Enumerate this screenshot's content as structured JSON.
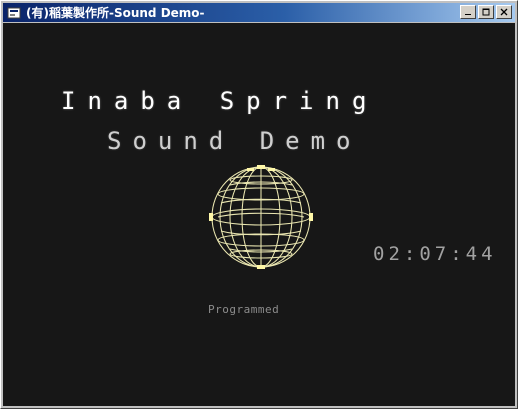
{
  "window": {
    "title": "(有)稲葉製作所-Sound Demo-",
    "controls": {
      "minimize": "minimize",
      "maximize": "maximize",
      "close": "close"
    },
    "icons": {
      "app": "app-icon",
      "minimize": "minimize-icon",
      "maximize": "maximize-icon",
      "close": "close-icon"
    }
  },
  "screen": {
    "title_main": "Inaba Spring",
    "title_sub": "Sound Demo",
    "timer": "02:07:44",
    "credit": "Programmed",
    "globe_icon": "wireframe-globe-icon",
    "colors": {
      "background": "#171717",
      "title_main": "#ffffff",
      "title_sub": "#cfcfcf",
      "timer": "#a1a1a1",
      "credit": "#8c8c8c",
      "globe": "#f4f0b8"
    }
  }
}
